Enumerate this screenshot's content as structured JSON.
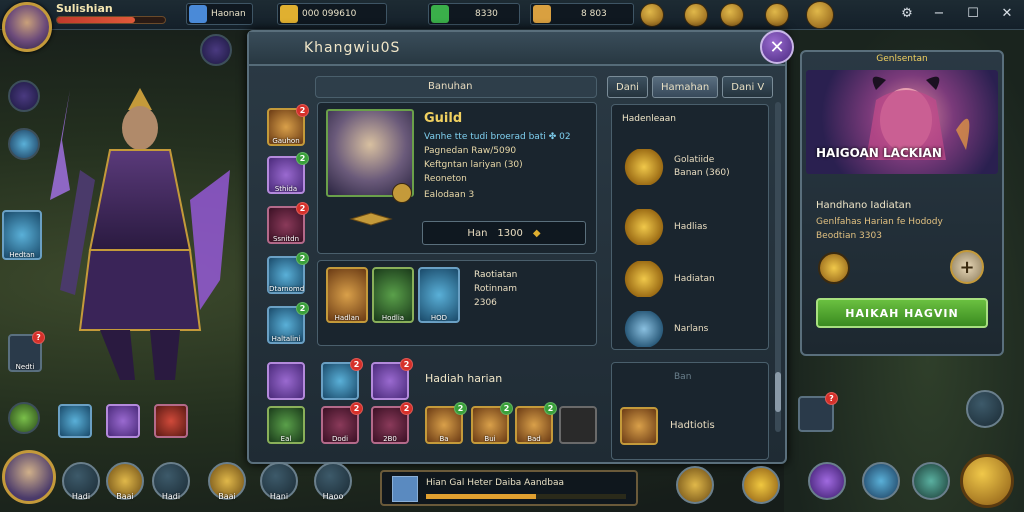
{
  "topbar": {
    "player_name": "Sulishian",
    "player_sub": "",
    "health_pct": 0.72,
    "gems_text": "",
    "resources": [
      {
        "label": "Haonan",
        "icon": "crystal-icon",
        "color": "#4a8ad8"
      },
      {
        "label": "000 099610",
        "icon": "gold-bar-icon",
        "color": "#e0b030"
      },
      {
        "label": "8330",
        "icon": "emerald-icon",
        "color": "#3ab04a"
      },
      {
        "label": "8 803",
        "icon": "gold-ingot-icon",
        "color": "#d9a040"
      }
    ],
    "window_controls": [
      "⚙",
      "−",
      "☐",
      "✕"
    ]
  },
  "left_column": {
    "side_labels": [
      "Hedtan"
    ],
    "bottom_labels": [
      "Nedti"
    ]
  },
  "panel": {
    "title": "Khangwiu0S",
    "section_label": "Banuhan",
    "tabs": [
      "Dani",
      "Hamahan",
      "Dani V"
    ],
    "side_slots": [
      {
        "caption": "Gauhon",
        "badge": "2"
      },
      {
        "caption": "Sthida",
        "badge": "2"
      },
      {
        "caption": "Ssnitdn",
        "badge": "2"
      },
      {
        "caption": "Dtarnomd",
        "badge": "2"
      },
      {
        "caption": "Haltalini",
        "badge": "2"
      }
    ],
    "guild": {
      "name": "Guild",
      "line1": "Vanhe tte tudi broerad bati ✤ 02",
      "line2": "Pagnedan Raw/5090",
      "line3": "Keftgntan lariyan (30)",
      "line4": "Reoneton",
      "line5": "Ealodaan 3",
      "bar_label": "Han",
      "bar_value": "1300"
    },
    "equip": {
      "items": [
        {
          "caption": "Hadlan"
        },
        {
          "caption": "Hodlia"
        },
        {
          "caption": "HOD"
        }
      ],
      "title": "Raotiatan",
      "sub1": "Rotinnam",
      "sub2": "2306"
    },
    "rewards_title": "Hadenleaan",
    "rewards": [
      {
        "line1": "Golatiide",
        "line2": "Banan (360)"
      },
      {
        "line1": "Hadlias",
        "line2": ""
      },
      {
        "line1": "Hadiatan",
        "line2": ""
      },
      {
        "line1": "Narlans",
        "line2": ""
      }
    ],
    "bottom": {
      "title": "Hadiah harian",
      "row1": [
        {
          "caption": ""
        },
        {
          "caption": ""
        },
        {
          "caption": ""
        }
      ],
      "row2": [
        {
          "caption": "Eal"
        },
        {
          "caption": "Dodi"
        },
        {
          "caption": "2B0"
        },
        {
          "caption": "Ba"
        },
        {
          "caption": "Bui"
        },
        {
          "caption": "Bad"
        },
        {
          "caption": ""
        }
      ]
    },
    "right_bottom_box": {
      "faint": "Ban",
      "label": "Hadtiotis"
    }
  },
  "right_card": {
    "title": "Genlsentan",
    "art_caption": "HAIGOAN LACKIAN",
    "heading": "Handhano Iadiatan",
    "line1": "Genlfahas Harian fe Hodody",
    "line2": "Beodtian 3303",
    "button": "HAIKAH HAGVIN"
  },
  "bottom_bar": {
    "labels": [
      "Hadi",
      "Baai",
      "Hadi",
      "Baai",
      "Hani",
      "Haoo"
    ],
    "strip_text": "Hian Gal Heter Daiba Aandbaa"
  },
  "colors": {
    "accent_gold": "#c49a3a",
    "accent_purple": "#9a6ad0",
    "panel_bg": "#2b3a45",
    "button_green": "#4aa02a",
    "badge_red": "#d6302a"
  }
}
